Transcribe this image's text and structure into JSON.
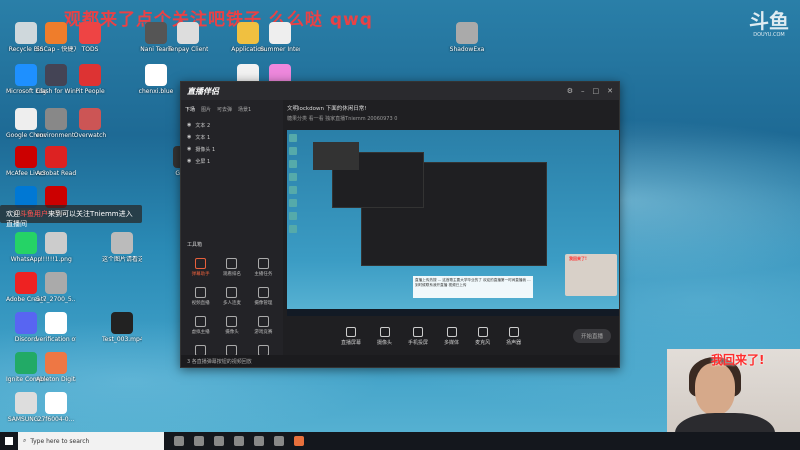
{
  "watermark": "观都来了点个关注吧铁子 么么哒 qwq",
  "brand": {
    "big": "斗鱼",
    "small": "DOUYU.COM"
  },
  "desktop_icons": [
    "Recycle Bin",
    "SSCap - 快捷方式",
    "TODS",
    "Nani Team",
    "Tenpay Client",
    "Application",
    "Summer Internship",
    "ShadowExa",
    "Microsoft Edge",
    "Clash for Windows",
    "Pit People",
    "chenxi.blue",
    "2019OC Shanghai",
    "GECC",
    "Google Chrome",
    "environment...",
    "Overwatch",
    "McAfee LiveSafe",
    "Acrobat Reader DC",
    "Gems",
    "应用商店",
    "McAfee",
    "WhatsApp",
    "!!!!!!1.png",
    "这个图片请看这里.mkv",
    "Adobe Creati...",
    "5_7_2700_5...",
    "Discord",
    "verification of Full-time...",
    "Test_003.mp4",
    "Ignite Compression",
    "Ableton Digital Editions 4.5",
    "SAMSUNG...",
    "27f6004-0..."
  ],
  "toast": {
    "prefix": "欢迎",
    "user": "斗鱼用户",
    "rest": "来到可以关注Tniemm进入直播间"
  },
  "app": {
    "logo": "直播伴侣",
    "stream_title": "文明lockdown 下面的休闲日常!",
    "title_tag": "修改",
    "sub": "糖果分类  看一看 独家直播Tniemm  20060973  0",
    "scene_tabs": [
      "下场",
      "图片",
      "可去弹",
      "场景1"
    ],
    "sources": [
      "文本 2",
      "文本 1",
      "摄像头 1",
      "全屏 1"
    ],
    "tools_title": "工具箱",
    "tools": [
      "弹幕助手",
      "观看排名",
      "主播任务",
      "视频直播",
      "多人连麦",
      "摄像管理",
      "虚拟主播",
      "摄像头",
      "游戏竞赛",
      "更多",
      "专用",
      "设置"
    ],
    "controls": [
      "直播屏幕",
      "摄像头",
      "手机投屏",
      "多媒体",
      "麦克风",
      "扬声器"
    ],
    "start_label": "开始直播",
    "status": "3 各直播弹幕按钮的视频回放",
    "preview_cam_caption": "我回来了!",
    "preview_caption": "直播上传热搜 ... 这首歌主要大学毕业的了 欢迎的直播第一时间直播我 ... 到时候联系我开直播 视频已上传"
  },
  "cam_caption": "我回来了!",
  "taskbar": {
    "search_placeholder": "Type here to search"
  }
}
